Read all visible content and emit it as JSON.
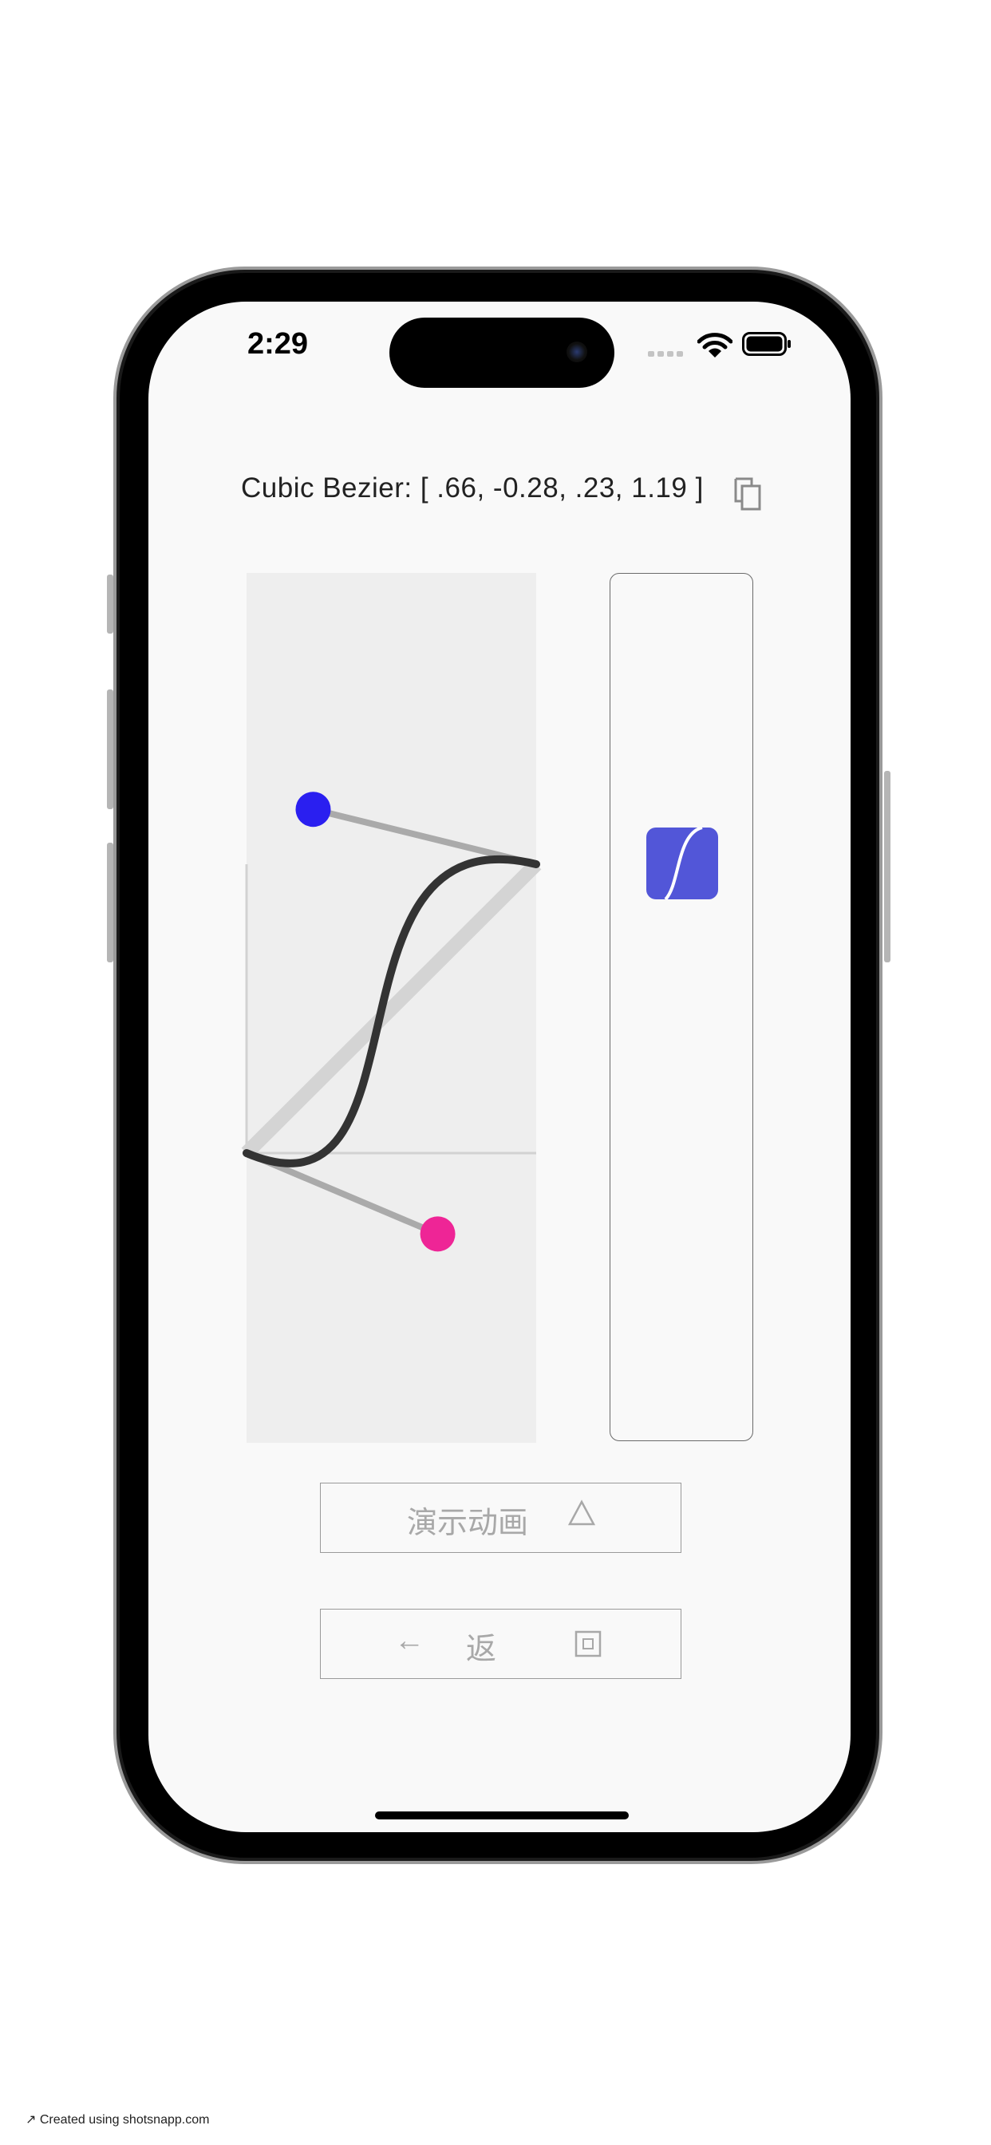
{
  "status_bar": {
    "time": "2:29",
    "icons": [
      "signal-icon",
      "wifi-icon",
      "battery-icon"
    ]
  },
  "header": {
    "title": "Cubic Bezier: [ .66, -0.28, .23, 1.19 ]",
    "copy_icon": "copy-icon"
  },
  "bezier": {
    "p1": [
      0.66,
      -0.28
    ],
    "p2": [
      0.23,
      1.19
    ]
  },
  "buttons": {
    "play_label": "演示动画",
    "play_icon": "△",
    "back_arrow": "←",
    "back_label": "返",
    "back_icon": "□"
  },
  "colors": {
    "p1_handle": "#ee2596",
    "p2_handle": "#2a1ff0",
    "curve": "#333333",
    "preview_square": "#5256d8"
  },
  "footer": {
    "credit": "Created using shotsnapp.com"
  }
}
